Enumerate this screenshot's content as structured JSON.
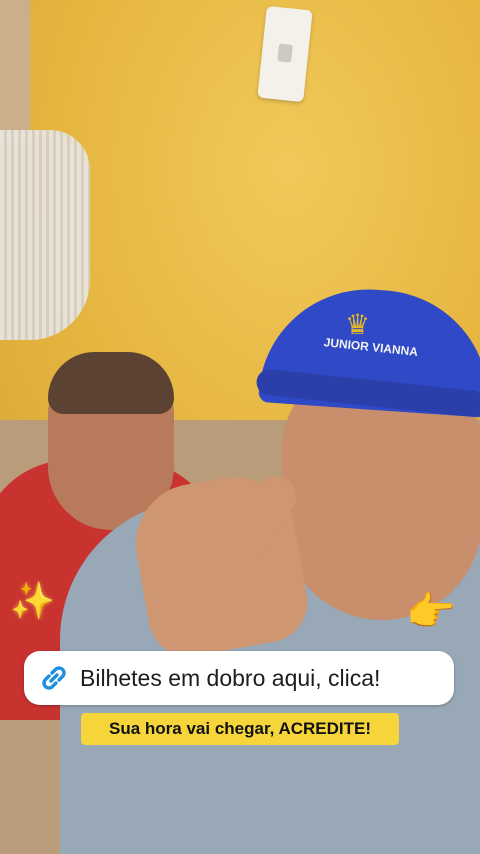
{
  "link_sticker": {
    "icon": "link-icon",
    "label": "Bilhetes em dobro aqui, clica!"
  },
  "caption": {
    "text": "Sua hora vai chegar, ACREDITE!",
    "background": "#f6d53b"
  },
  "decorations": {
    "sparkles": "✨",
    "pointing_emoji": "👉"
  },
  "cap_logo": "JUNIOR VIANNA"
}
